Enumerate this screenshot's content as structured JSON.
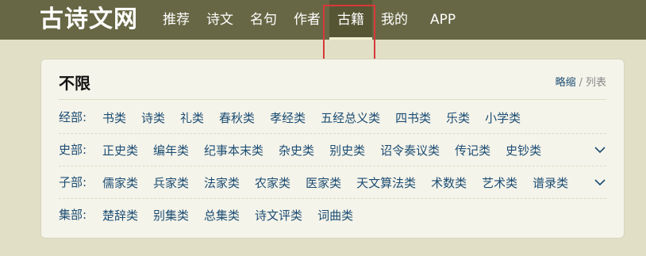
{
  "header": {
    "logo": "古诗文网",
    "nav": [
      "推荐",
      "诗文",
      "名句",
      "作者",
      "古籍",
      "我的",
      "APP"
    ],
    "active_index": 4
  },
  "panel": {
    "title": "不限",
    "view_active": "略缩",
    "view_sep": "/",
    "view_other": "列表",
    "rows": [
      {
        "label": "经部:",
        "items": [
          "书类",
          "诗类",
          "礼类",
          "春秋类",
          "孝经类",
          "五经总义类",
          "四书类",
          "乐类",
          "小学类"
        ],
        "expandable": false
      },
      {
        "label": "史部:",
        "items": [
          "正史类",
          "编年类",
          "纪事本末类",
          "杂史类",
          "别史类",
          "诏令奏议类",
          "传记类",
          "史钞类"
        ],
        "expandable": true
      },
      {
        "label": "子部:",
        "items": [
          "儒家类",
          "兵家类",
          "法家类",
          "农家类",
          "医家类",
          "天文算法类",
          "术数类",
          "艺术类",
          "谱录类"
        ],
        "expandable": true
      },
      {
        "label": "集部:",
        "items": [
          "楚辞类",
          "别集类",
          "总集类",
          "诗文评类",
          "词曲类"
        ],
        "expandable": false
      }
    ]
  },
  "colors": {
    "header_bg": "#676745",
    "page_bg": "#e1e0c7",
    "link": "#1c4d74",
    "highlight_border": "#d9373a"
  },
  "icons": {
    "expand": "chevron-down-icon"
  }
}
